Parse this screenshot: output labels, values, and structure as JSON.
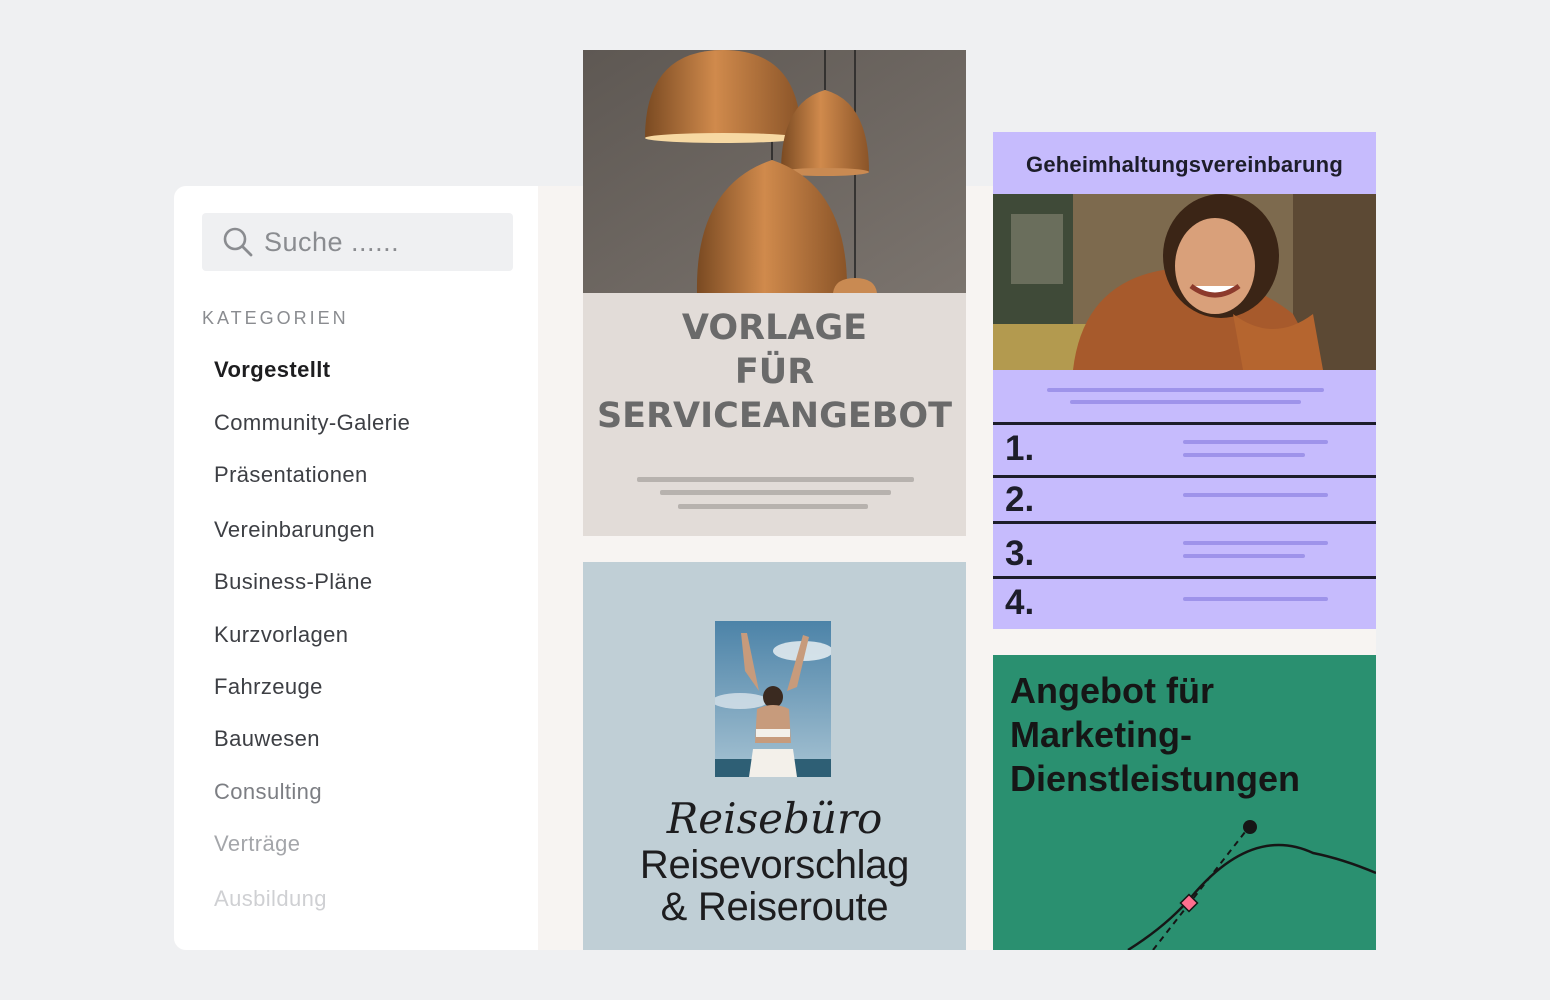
{
  "search": {
    "placeholder": "Suche ......"
  },
  "categories": {
    "heading": "KATEGORIEN",
    "items": [
      {
        "label": "Vorgestellt"
      },
      {
        "label": "Community-Galerie"
      },
      {
        "label": "Präsentationen"
      },
      {
        "label": "Vereinbarungen"
      },
      {
        "label": "Business-Pläne"
      },
      {
        "label": "Kurzvorlagen"
      },
      {
        "label": "Fahrzeuge"
      },
      {
        "label": "Bauwesen"
      },
      {
        "label": "Consulting"
      },
      {
        "label": "Verträge"
      },
      {
        "label": "Ausbildung"
      }
    ]
  },
  "templates": {
    "service": {
      "title": "VORLAGE\nFÜR\nSERVICEANGEBOT"
    },
    "travel": {
      "script": "Reisebüro",
      "title": "Reisevorschlag\n& Reiseroute"
    },
    "nda": {
      "title": "Geheimhaltungsvereinbarung",
      "rows": [
        "1.",
        "2.",
        "3.",
        "4."
      ]
    },
    "marketing": {
      "title": "Angebot für\nMarketing-\nDienstleistungen"
    }
  },
  "colors": {
    "background": "#eff0f2",
    "nda_card": "#c6bbfd",
    "marketing_card": "#2a9070",
    "travel_card": "#c0cfd6",
    "service_card": "#e2dcd8"
  },
  "icons": {
    "search": "search-icon"
  }
}
